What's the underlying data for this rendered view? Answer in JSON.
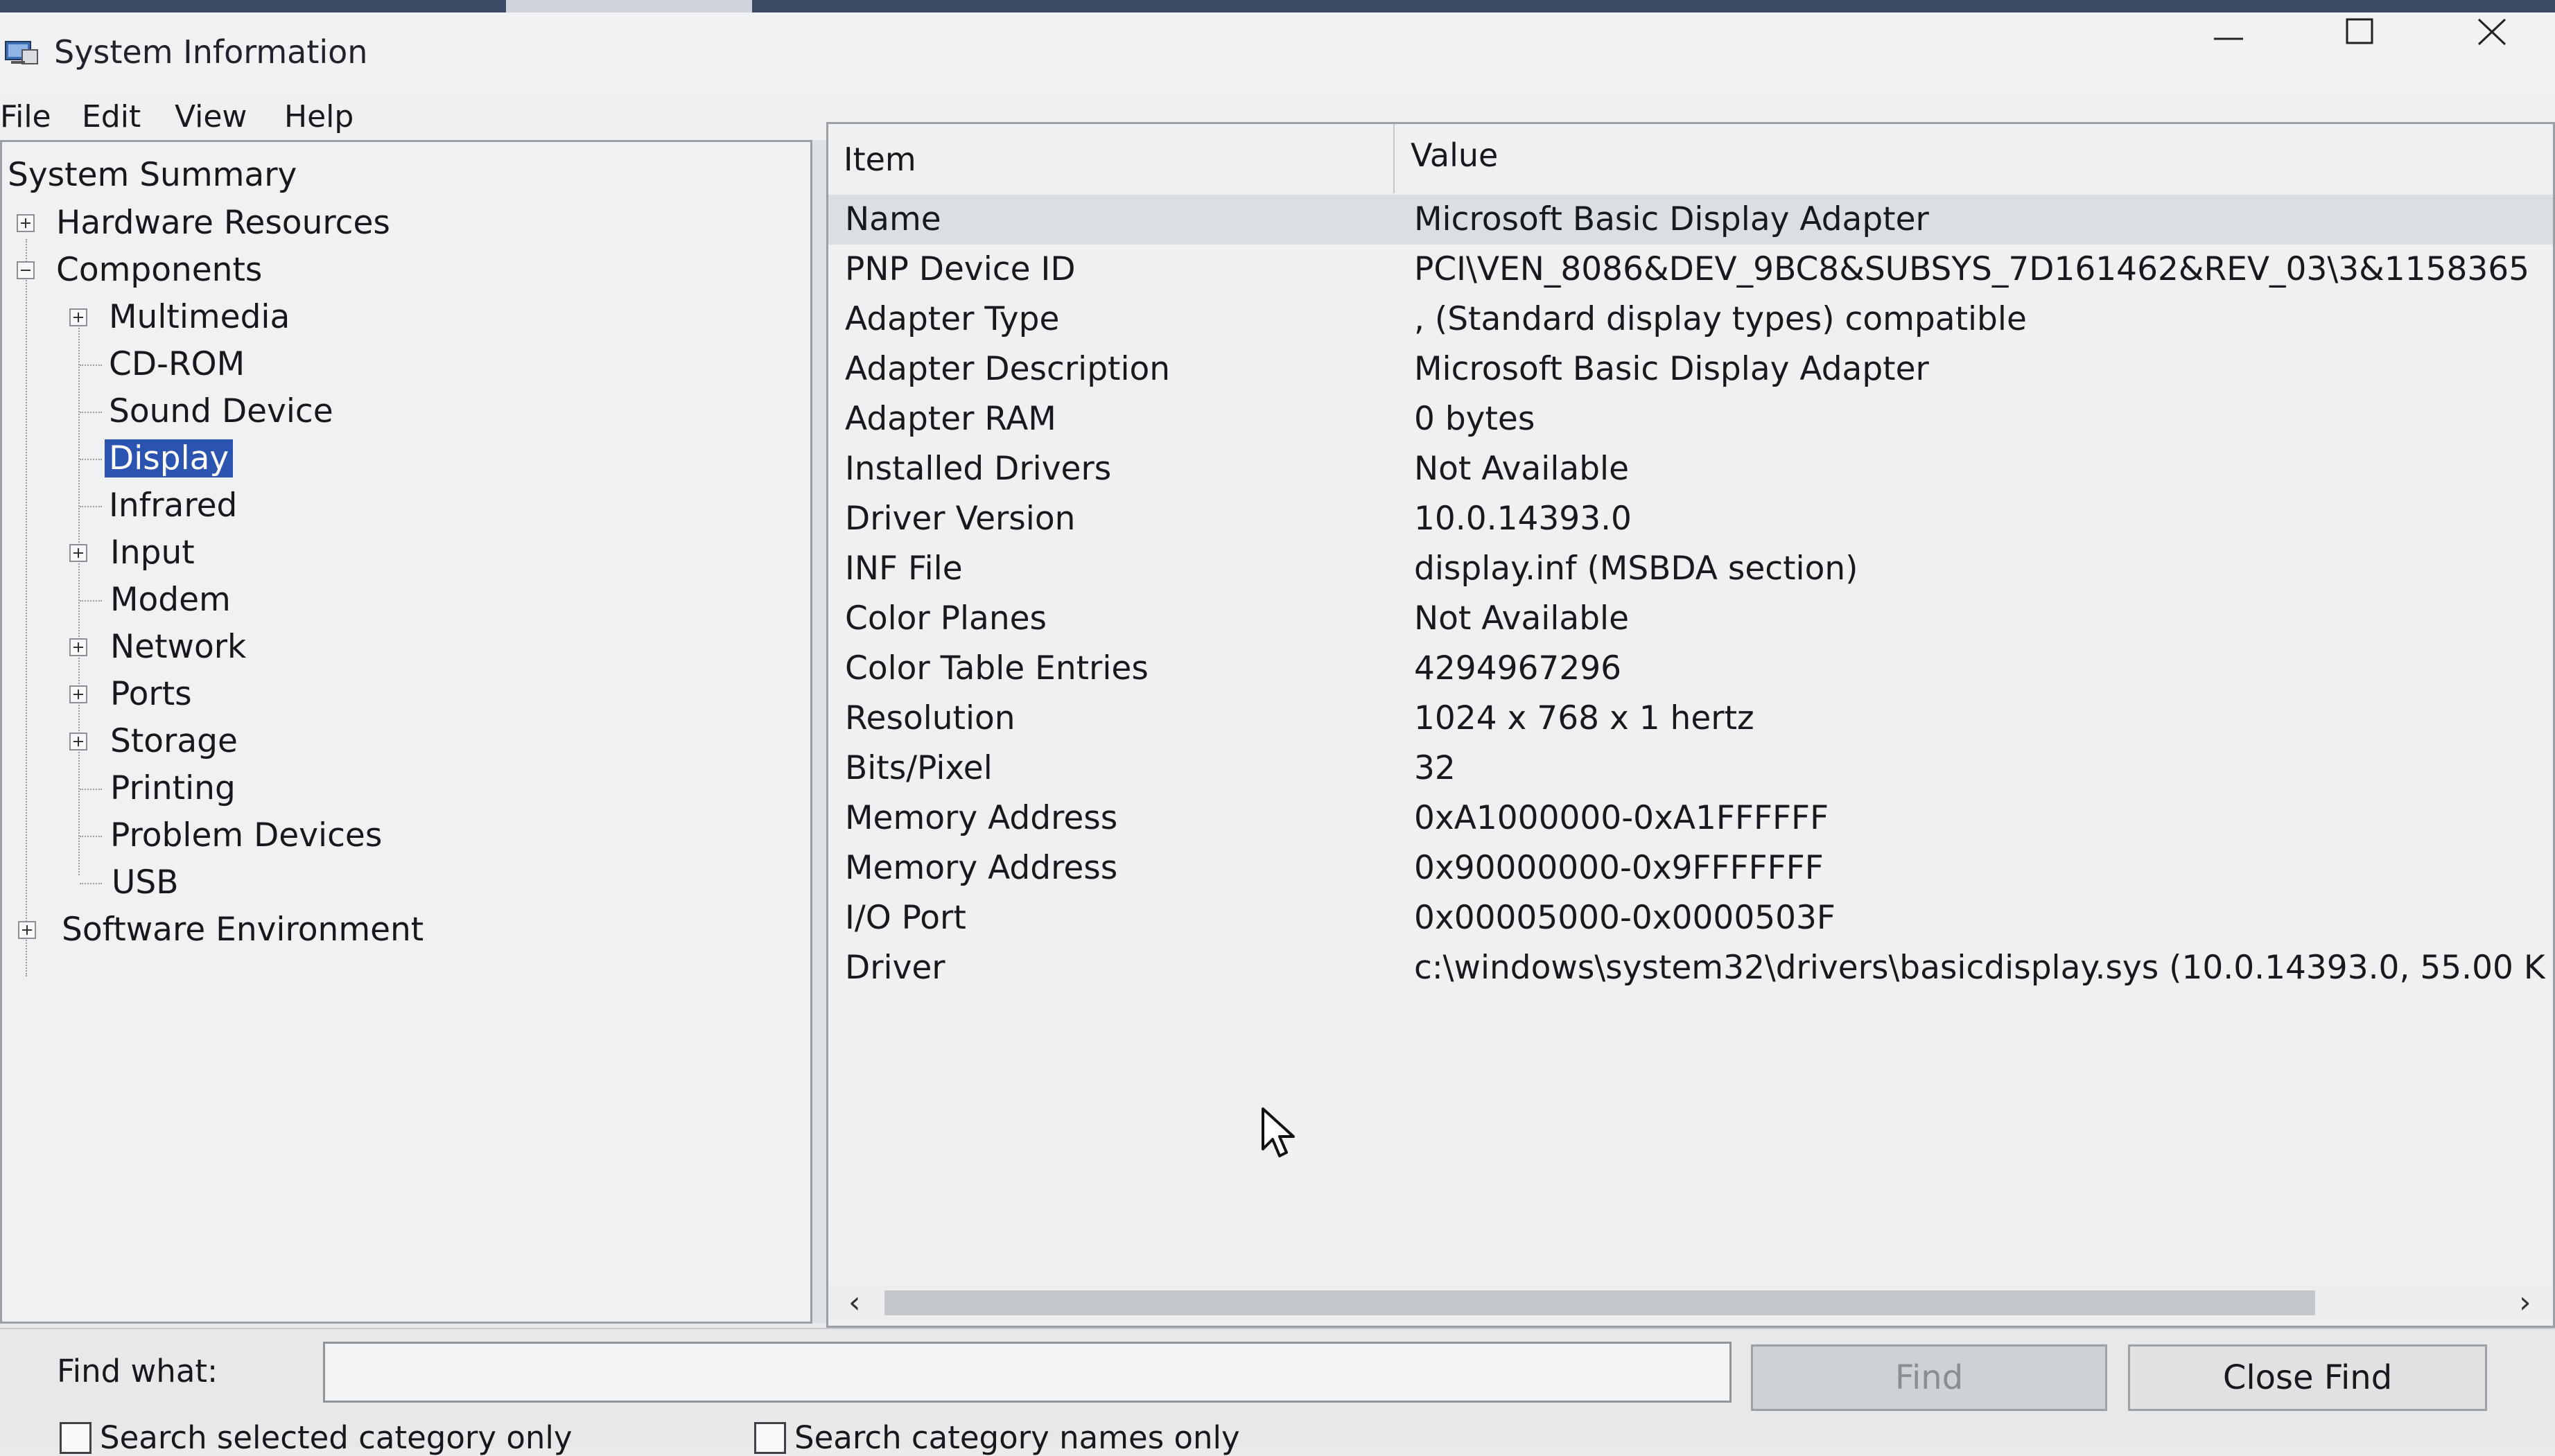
{
  "window": {
    "title": "System Information",
    "icon": "system-information-icon",
    "controls": [
      "minimize-icon",
      "maximize-icon",
      "close-icon"
    ]
  },
  "menu": [
    "File",
    "Edit",
    "View",
    "Help"
  ],
  "tree": {
    "root": "System Summary",
    "items": [
      {
        "label": "Hardware Resources",
        "expander": "plus"
      },
      {
        "label": "Components",
        "expander": "minus"
      },
      {
        "label": "Multimedia",
        "expander": "plus"
      },
      {
        "label": "CD-ROM"
      },
      {
        "label": "Sound Device"
      },
      {
        "label": "Display",
        "selected": true
      },
      {
        "label": "Infrared"
      },
      {
        "label": "Input",
        "expander": "plus"
      },
      {
        "label": "Modem"
      },
      {
        "label": "Network",
        "expander": "plus"
      },
      {
        "label": "Ports",
        "expander": "plus"
      },
      {
        "label": "Storage",
        "expander": "plus"
      },
      {
        "label": "Printing"
      },
      {
        "label": "Problem Devices"
      },
      {
        "label": "USB"
      },
      {
        "label": "Software Environment",
        "expander": "plus"
      }
    ]
  },
  "details": {
    "columns": [
      "Item",
      "Value"
    ],
    "rows": [
      {
        "item": "Name",
        "value": "Microsoft Basic Display Adapter"
      },
      {
        "item": "PNP Device ID",
        "value": "PCI\\VEN_8086&DEV_9BC8&SUBSYS_7D161462&REV_03\\3&1158365"
      },
      {
        "item": "Adapter Type",
        "value": ", (Standard display types) compatible"
      },
      {
        "item": "Adapter Description",
        "value": "Microsoft Basic Display Adapter"
      },
      {
        "item": "Adapter RAM",
        "value": "0 bytes"
      },
      {
        "item": "Installed Drivers",
        "value": "Not Available"
      },
      {
        "item": "Driver Version",
        "value": "10.0.14393.0"
      },
      {
        "item": "INF File",
        "value": "display.inf (MSBDA section)"
      },
      {
        "item": "Color Planes",
        "value": "Not Available"
      },
      {
        "item": "Color Table Entries",
        "value": "4294967296"
      },
      {
        "item": "Resolution",
        "value": "1024 x 768 x 1 hertz"
      },
      {
        "item": "Bits/Pixel",
        "value": "32"
      },
      {
        "item": "Memory Address",
        "value": "0xA1000000-0xA1FFFFFF"
      },
      {
        "item": "Memory Address",
        "value": "0x90000000-0x9FFFFFFF"
      },
      {
        "item": "I/O Port",
        "value": "0x00005000-0x0000503F"
      },
      {
        "item": "Driver",
        "value": "c:\\windows\\system32\\drivers\\basicdisplay.sys (10.0.14393.0, 55.00 K"
      }
    ]
  },
  "scrollbar": {
    "left_arrow": "‹",
    "right_arrow": "›"
  },
  "findbar": {
    "label": "Find what:",
    "value": "",
    "find_button": "Find",
    "close_button": "Close Find",
    "check_selected_category": "Search selected category only",
    "check_category_names": "Search category names only"
  }
}
